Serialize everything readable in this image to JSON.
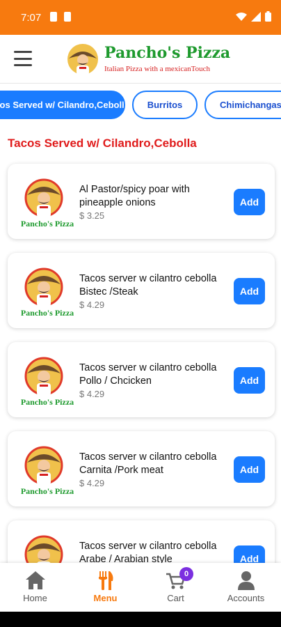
{
  "status_bar": {
    "time": "7:07"
  },
  "header": {
    "brand_name": "Pancho's Pizza",
    "tagline": "Italian Pizza with a mexicanTouch"
  },
  "categories": [
    {
      "label": "Tacos Served w/ Cilandro,Cebolla",
      "active": true
    },
    {
      "label": "Burritos",
      "active": false
    },
    {
      "label": "Chimichangas",
      "active": false
    }
  ],
  "section_title": "Tacos Served w/ Cilandro,Cebolla",
  "logo_caption": "Pancho's Pizza",
  "items": [
    {
      "name": "Al Pastor/spicy poar with pineapple onions",
      "price": "$ 3.25",
      "add_label": "Add"
    },
    {
      "name": "Tacos server w cilantro cebolla Bistec /Steak",
      "price": "$ 4.29",
      "add_label": "Add"
    },
    {
      "name": "Tacos server w cilantro cebolla Pollo / Chcicken",
      "price": "$ 4.29",
      "add_label": "Add"
    },
    {
      "name": "Tacos server w cilantro cebolla Carnita /Pork meat",
      "price": "$ 4.29",
      "add_label": "Add"
    },
    {
      "name": "Tacos server w cilantro cebolla Arabe / Arabian style",
      "price": "",
      "add_label": "Add"
    }
  ],
  "bottom_nav": {
    "home": "Home",
    "menu": "Menu",
    "cart": "Cart",
    "cart_count": "0",
    "accounts": "Accounts"
  },
  "colors": {
    "status_bar": "#f77a0f",
    "accent_blue": "#1a7cff",
    "brand_green": "#1e9a2e",
    "section_red": "#e01b1b",
    "cart_badge": "#7b2fe0"
  }
}
